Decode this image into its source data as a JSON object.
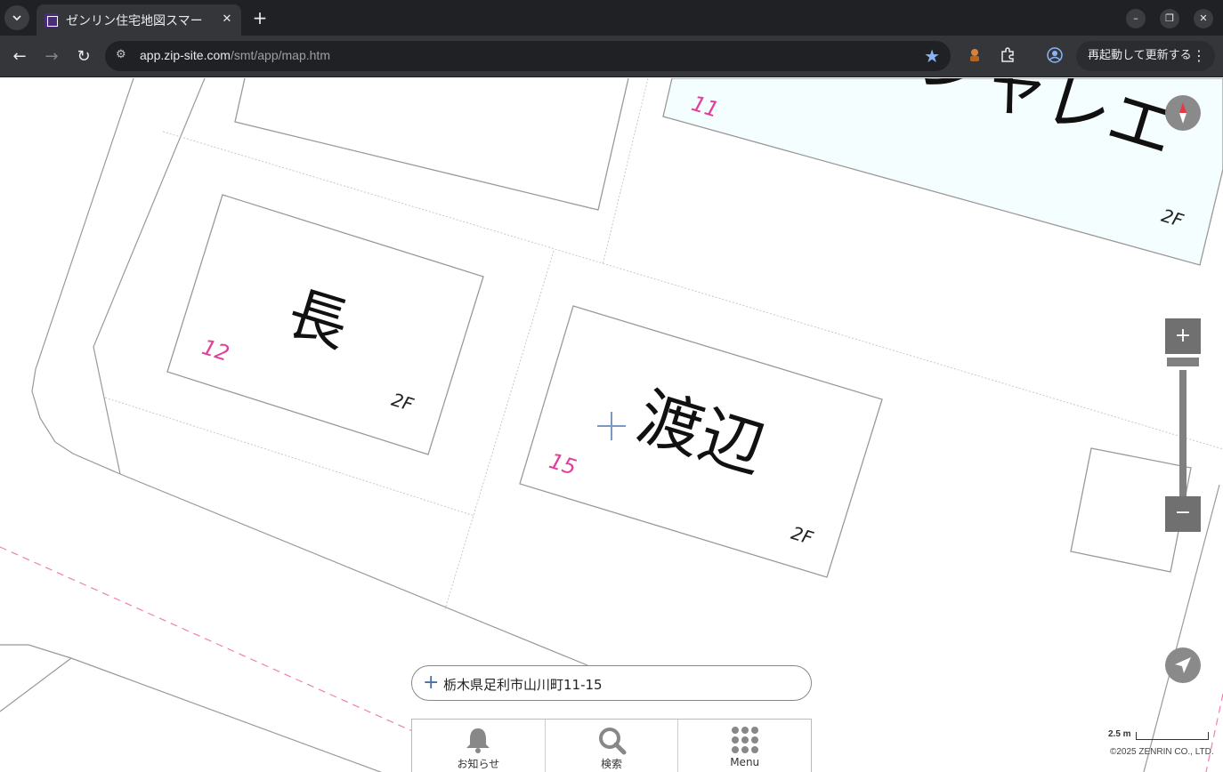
{
  "browser": {
    "tab_title": "ゼンリン住宅地図スマー",
    "url_host": "app.zip-site.com",
    "url_path": "/smt/app/map.htm",
    "relaunch_label": "再起動して更新する"
  },
  "map": {
    "buildings": [
      {
        "name": "長",
        "lot": "12",
        "floors": "2F"
      },
      {
        "name": "渡辺",
        "lot": "15",
        "floors": "2F"
      },
      {
        "name": "シャレエ",
        "lot": "11",
        "floors": "2F"
      }
    ],
    "address": "栃木県足利市山川町11-15",
    "scale_label": "2.5 m",
    "copyright": "©2025 ZENRIN CO., LTD."
  },
  "controls": {
    "zoom_in": "+",
    "zoom_out": "−"
  },
  "menu": {
    "items": [
      {
        "label": "お知らせ",
        "icon": "bell-icon"
      },
      {
        "label": "検索",
        "icon": "search-icon"
      },
      {
        "label": "Menu",
        "icon": "grid-menu-icon"
      }
    ]
  }
}
